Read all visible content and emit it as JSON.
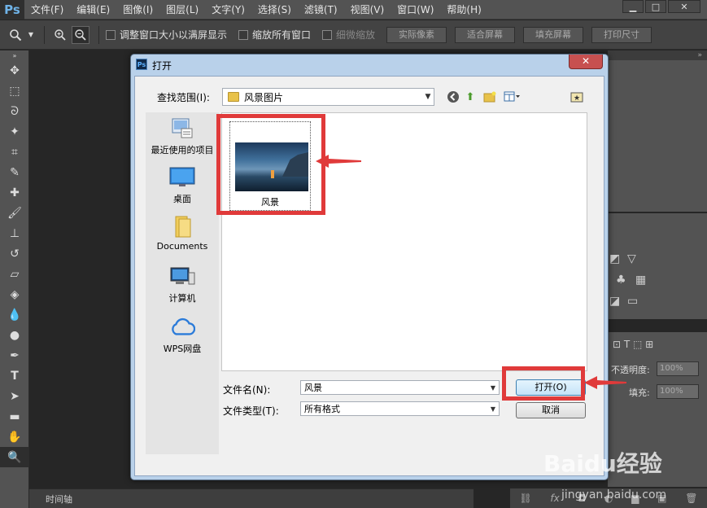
{
  "app": {
    "logo": "Ps",
    "menu": [
      "文件(F)",
      "编辑(E)",
      "图像(I)",
      "图层(L)",
      "文字(Y)",
      "选择(S)",
      "滤镜(T)",
      "视图(V)",
      "窗口(W)",
      "帮助(H)"
    ],
    "window_buttons": [
      "▁",
      "□",
      "✕"
    ]
  },
  "options": {
    "check1": "调整窗口大小以满屏显示",
    "check2": "缩放所有窗口",
    "check3": "细微缩放",
    "btn_actual": "实际像素",
    "btn_fit": "适合屏幕",
    "btn_fill": "填充屏幕",
    "btn_print": "打印尺寸"
  },
  "panels": {
    "opacity_label": "不透明度:",
    "opacity_value": "100%",
    "fill_label": "填充:",
    "fill_value": "100%"
  },
  "timeline": {
    "tab": "时间轴"
  },
  "dialog": {
    "title": "打开",
    "close": "✕",
    "lookin_label": "查找范围(I):",
    "lookin_value": "风景图片",
    "places": [
      {
        "label": "最近使用的项目"
      },
      {
        "label": "桌面"
      },
      {
        "label": "Documents"
      },
      {
        "label": "计算机"
      },
      {
        "label": "WPS网盘"
      }
    ],
    "files": [
      {
        "name": "风景"
      }
    ],
    "filename_label": "文件名(N):",
    "filename_value": "风景",
    "filetype_label": "文件类型(T):",
    "filetype_value": "所有格式",
    "open_button": "打开(O)",
    "cancel_button": "取消"
  },
  "watermark": {
    "main": "Baidu经验",
    "sub": "jingyan.baidu.com"
  },
  "colors": {
    "highlight": "#e03a3a",
    "dialog_frame": "#b9d1ea",
    "panel": "#535353"
  }
}
